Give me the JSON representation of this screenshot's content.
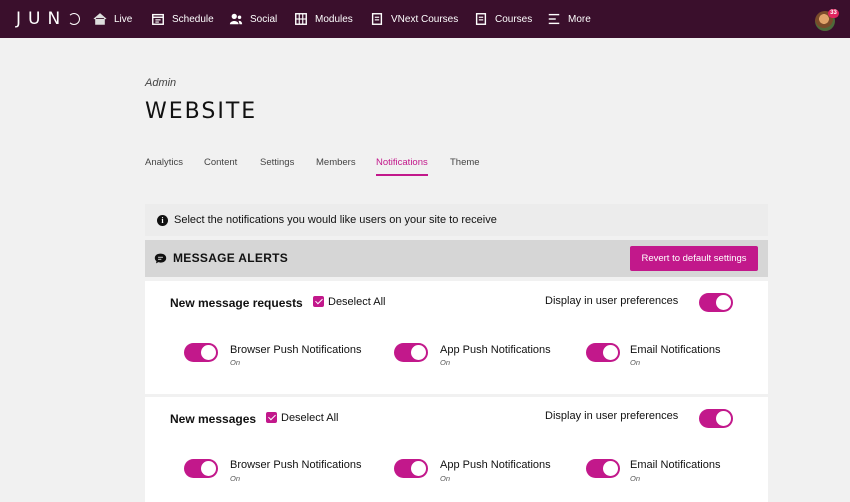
{
  "nav": {
    "logo": "JUN",
    "items": [
      {
        "label": "Live",
        "icon": "home-icon"
      },
      {
        "label": "Schedule",
        "icon": "calendar-icon"
      },
      {
        "label": "Social",
        "icon": "users-icon"
      },
      {
        "label": "Modules",
        "icon": "grid-icon"
      },
      {
        "label": "VNext Courses",
        "icon": "book-icon"
      },
      {
        "label": "Courses",
        "icon": "book-icon"
      },
      {
        "label": "More",
        "icon": "menu-icon"
      }
    ],
    "notification_count": "33"
  },
  "header": {
    "breadcrumb": "Admin",
    "title": "WEBSITE",
    "tabs": [
      "Analytics",
      "Content",
      "Settings",
      "Members",
      "Notifications",
      "Theme"
    ],
    "active_tab": "Notifications"
  },
  "info_text": "Select the notifications you would like users on your site to receive",
  "section": {
    "title": "MESSAGE ALERTS",
    "revert_label": "Revert to default settings"
  },
  "cards": [
    {
      "title": "New message requests",
      "deselect_label": "Deselect All",
      "pref_label": "Display in user preferences",
      "options": [
        {
          "label": "Browser Push Notifications",
          "state": "On"
        },
        {
          "label": "App Push Notifications",
          "state": "On"
        },
        {
          "label": "Email Notifications",
          "state": "On"
        }
      ]
    },
    {
      "title": "New messages",
      "deselect_label": "Deselect All",
      "pref_label": "Display in user preferences",
      "options": [
        {
          "label": "Browser Push Notifications",
          "state": "On"
        },
        {
          "label": "App Push Notifications",
          "state": "On"
        },
        {
          "label": "Email Notifications",
          "state": "On"
        }
      ]
    }
  ],
  "colors": {
    "accent": "#c2188b",
    "nav_bg": "#3a0f2c"
  }
}
